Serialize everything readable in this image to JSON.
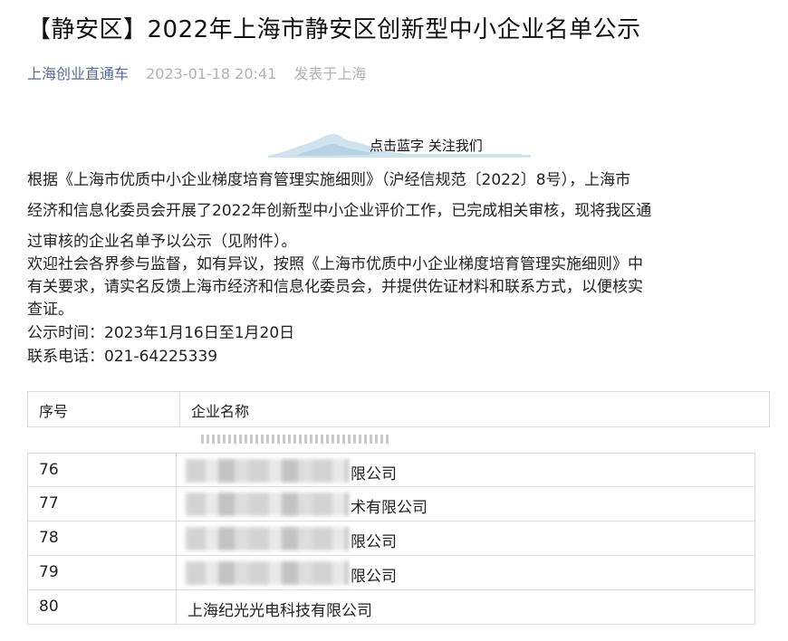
{
  "article": {
    "title": "【静安区】2022年上海市静安区创新型中小企业名单公示",
    "author": "上海创业直通车",
    "date": "2023-01-18 20:41",
    "location": "发表于上海"
  },
  "follow_banner": {
    "text": "点击蓝字 关注我们",
    "icon": "mountain-illustration-icon"
  },
  "body": {
    "p1_lines": [
      "根据《上海市优质中小企业梯度培育管理实施细则》（沪经信规范〔2022〕8号），上海市",
      "经济和信息化委员会开展了2022年创新型中小企业评价工作，已完成相关审核，现将我区通",
      "过审核的企业名单予以公示（见附件）。"
    ],
    "p2_lines": [
      "欢迎社会各界参与监督，如有异议，按照《上海市优质中小企业梯度培育管理实施细则》中",
      "有关要求，请实名反馈上海市经济和信息化委员会，并提供佐证材料和联系方式，以便核实",
      "查证。"
    ],
    "publicity_time": "公示时间：2023年1月16日至1月20日",
    "contact_phone": "联系电话：021-64225339"
  },
  "table": {
    "headers": [
      "序号",
      "企业名称"
    ],
    "rows": [
      {
        "num": "76",
        "name_prefix": "",
        "name_suffix": "限公司",
        "blurred": true
      },
      {
        "num": "77",
        "name_prefix": "",
        "name_suffix": "术有限公司",
        "blurred": true
      },
      {
        "num": "78",
        "name_prefix": "",
        "name_suffix": "限公司",
        "blurred": true
      },
      {
        "num": "79",
        "name_prefix": "",
        "name_suffix": "限公司",
        "blurred": true
      },
      {
        "num": "80",
        "name_prefix": "上海纪光光电科技有限公司",
        "name_suffix": "",
        "blurred": false
      }
    ]
  }
}
